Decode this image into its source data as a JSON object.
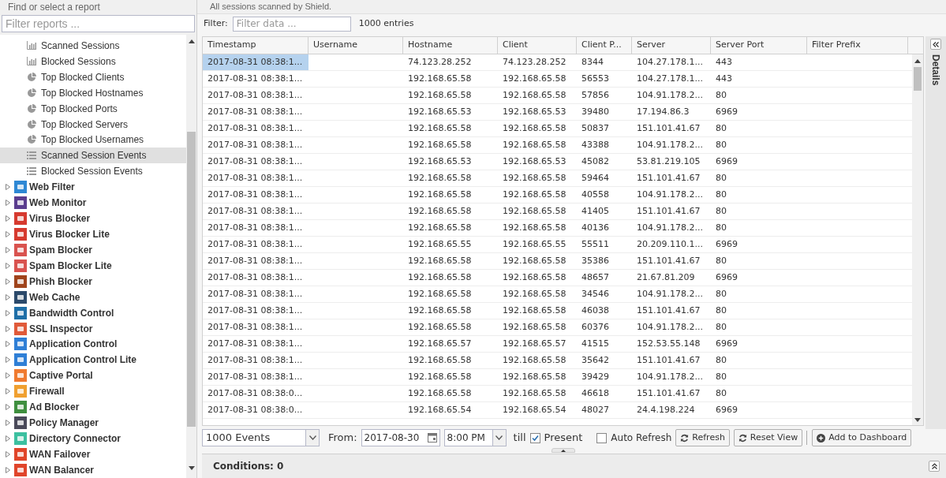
{
  "sidebar": {
    "title": "Find or select a report",
    "filter": {
      "placeholder": "Filter reports ..."
    },
    "reports": [
      {
        "kind": "bar",
        "label": "Scanned Sessions",
        "selected": false
      },
      {
        "kind": "bar",
        "label": "Blocked Sessions",
        "selected": false
      },
      {
        "kind": "pie",
        "label": "Top Blocked Clients",
        "selected": false
      },
      {
        "kind": "pie",
        "label": "Top Blocked Hostnames",
        "selected": false
      },
      {
        "kind": "pie",
        "label": "Top Blocked Ports",
        "selected": false
      },
      {
        "kind": "pie",
        "label": "Top Blocked Servers",
        "selected": false
      },
      {
        "kind": "pie",
        "label": "Top Blocked Usernames",
        "selected": false
      },
      {
        "kind": "list",
        "label": "Scanned Session Events",
        "selected": true
      },
      {
        "kind": "list",
        "label": "Blocked Session Events",
        "selected": false
      }
    ],
    "apps": [
      {
        "label": "Web Filter",
        "color": "#2e88d4",
        "expanded": false
      },
      {
        "label": "Web Monitor",
        "color": "#5b3d8f",
        "expanded": false
      },
      {
        "label": "Virus Blocker",
        "color": "#d63a2f",
        "expanded": false
      },
      {
        "label": "Virus Blocker Lite",
        "color": "#d63a2f",
        "expanded": false
      },
      {
        "label": "Spam Blocker",
        "color": "#d9534f",
        "expanded": false
      },
      {
        "label": "Spam Blocker Lite",
        "color": "#d9534f",
        "expanded": false
      },
      {
        "label": "Phish Blocker",
        "color": "#a0441c",
        "expanded": false
      },
      {
        "label": "Web Cache",
        "color": "#2c4a6b",
        "expanded": false
      },
      {
        "label": "Bandwidth Control",
        "color": "#1f6fa8",
        "expanded": false
      },
      {
        "label": "SSL Inspector",
        "color": "#e05a3a",
        "expanded": false
      },
      {
        "label": "Application Control",
        "color": "#2f7fd6",
        "expanded": false
      },
      {
        "label": "Application Control Lite",
        "color": "#2f7fd6",
        "expanded": false
      },
      {
        "label": "Captive Portal",
        "color": "#f07a2f",
        "expanded": false
      },
      {
        "label": "Firewall",
        "color": "#f0a030",
        "expanded": false
      },
      {
        "label": "Ad Blocker",
        "color": "#3f8f3f",
        "expanded": false
      },
      {
        "label": "Policy Manager",
        "color": "#4a4a5a",
        "expanded": false
      },
      {
        "label": "Directory Connector",
        "color": "#3cc0a0",
        "expanded": false
      },
      {
        "label": "WAN Failover",
        "color": "#e0452a",
        "expanded": false
      },
      {
        "label": "WAN Balancer",
        "color": "#e0452b",
        "expanded": false
      }
    ]
  },
  "description": "All sessions scanned by Shield.",
  "filter_bar": {
    "label": "Filter:",
    "placeholder": "Filter data ...",
    "count": "1000 entries"
  },
  "table": {
    "columns": [
      "Timestamp",
      "Username",
      "Hostname",
      "Client",
      "Client P...",
      "Server",
      "Server Port",
      "Filter Prefix"
    ],
    "rows": [
      {
        "selected": true,
        "cells": [
          "2017-08-31 08:38:1...",
          "",
          "74.123.28.252",
          "74.123.28.252",
          "8344",
          "104.27.178.1...",
          "443",
          ""
        ]
      },
      {
        "selected": false,
        "cells": [
          "2017-08-31 08:38:1...",
          "",
          "192.168.65.58",
          "192.168.65.58",
          "56553",
          "104.27.178.1...",
          "443",
          ""
        ]
      },
      {
        "selected": false,
        "cells": [
          "2017-08-31 08:38:1...",
          "",
          "192.168.65.58",
          "192.168.65.58",
          "57856",
          "104.91.178.2...",
          "80",
          ""
        ]
      },
      {
        "selected": false,
        "cells": [
          "2017-08-31 08:38:1...",
          "",
          "192.168.65.53",
          "192.168.65.53",
          "39480",
          "17.194.86.3",
          "6969",
          ""
        ]
      },
      {
        "selected": false,
        "cells": [
          "2017-08-31 08:38:1...",
          "",
          "192.168.65.58",
          "192.168.65.58",
          "50837",
          "151.101.41.67",
          "80",
          ""
        ]
      },
      {
        "selected": false,
        "cells": [
          "2017-08-31 08:38:1...",
          "",
          "192.168.65.58",
          "192.168.65.58",
          "43388",
          "104.91.178.2...",
          "80",
          ""
        ]
      },
      {
        "selected": false,
        "cells": [
          "2017-08-31 08:38:1...",
          "",
          "192.168.65.53",
          "192.168.65.53",
          "45082",
          "53.81.219.105",
          "6969",
          ""
        ]
      },
      {
        "selected": false,
        "cells": [
          "2017-08-31 08:38:1...",
          "",
          "192.168.65.58",
          "192.168.65.58",
          "59464",
          "151.101.41.67",
          "80",
          ""
        ]
      },
      {
        "selected": false,
        "cells": [
          "2017-08-31 08:38:1...",
          "",
          "192.168.65.58",
          "192.168.65.58",
          "40558",
          "104.91.178.2...",
          "80",
          ""
        ]
      },
      {
        "selected": false,
        "cells": [
          "2017-08-31 08:38:1...",
          "",
          "192.168.65.58",
          "192.168.65.58",
          "41405",
          "151.101.41.67",
          "80",
          ""
        ]
      },
      {
        "selected": false,
        "cells": [
          "2017-08-31 08:38:1...",
          "",
          "192.168.65.58",
          "192.168.65.58",
          "40136",
          "104.91.178.2...",
          "80",
          ""
        ]
      },
      {
        "selected": false,
        "cells": [
          "2017-08-31 08:38:1...",
          "",
          "192.168.65.55",
          "192.168.65.55",
          "55511",
          "20.209.110.1...",
          "6969",
          ""
        ]
      },
      {
        "selected": false,
        "cells": [
          "2017-08-31 08:38:1...",
          "",
          "192.168.65.58",
          "192.168.65.58",
          "35386",
          "151.101.41.67",
          "80",
          ""
        ]
      },
      {
        "selected": false,
        "cells": [
          "2017-08-31 08:38:1...",
          "",
          "192.168.65.58",
          "192.168.65.58",
          "48657",
          "21.67.81.209",
          "6969",
          ""
        ]
      },
      {
        "selected": false,
        "cells": [
          "2017-08-31 08:38:1...",
          "",
          "192.168.65.58",
          "192.168.65.58",
          "34546",
          "104.91.178.2...",
          "80",
          ""
        ]
      },
      {
        "selected": false,
        "cells": [
          "2017-08-31 08:38:1...",
          "",
          "192.168.65.58",
          "192.168.65.58",
          "46038",
          "151.101.41.67",
          "80",
          ""
        ]
      },
      {
        "selected": false,
        "cells": [
          "2017-08-31 08:38:1...",
          "",
          "192.168.65.58",
          "192.168.65.58",
          "60376",
          "104.91.178.2...",
          "80",
          ""
        ]
      },
      {
        "selected": false,
        "cells": [
          "2017-08-31 08:38:1...",
          "",
          "192.168.65.57",
          "192.168.65.57",
          "41515",
          "152.53.55.148",
          "6969",
          ""
        ]
      },
      {
        "selected": false,
        "cells": [
          "2017-08-31 08:38:1...",
          "",
          "192.168.65.58",
          "192.168.65.58",
          "35642",
          "151.101.41.67",
          "80",
          ""
        ]
      },
      {
        "selected": false,
        "cells": [
          "2017-08-31 08:38:1...",
          "",
          "192.168.65.58",
          "192.168.65.58",
          "39429",
          "104.91.178.2...",
          "80",
          ""
        ]
      },
      {
        "selected": false,
        "cells": [
          "2017-08-31 08:38:0...",
          "",
          "192.168.65.58",
          "192.168.65.58",
          "46618",
          "151.101.41.67",
          "80",
          ""
        ]
      },
      {
        "selected": false,
        "cells": [
          "2017-08-31 08:38:0...",
          "",
          "192.168.65.54",
          "192.168.65.54",
          "48027",
          "24.4.198.224",
          "6969",
          ""
        ]
      }
    ]
  },
  "details_panel": {
    "label": "Details"
  },
  "toolbar": {
    "limit": "1000 Events",
    "from_label": "From:",
    "date": "2017-08-30",
    "time": "8:00 PM",
    "till_label": "till",
    "present": {
      "label": "Present",
      "checked": true
    },
    "auto_refresh": {
      "label": "Auto Refresh",
      "checked": false
    },
    "buttons": [
      {
        "kind": "refresh",
        "label": "Refresh"
      },
      {
        "kind": "reset",
        "label": "Reset View"
      },
      {
        "kind": "add",
        "label": "Add to Dashboard"
      }
    ]
  },
  "conditions": {
    "label": "Conditions: 0"
  }
}
